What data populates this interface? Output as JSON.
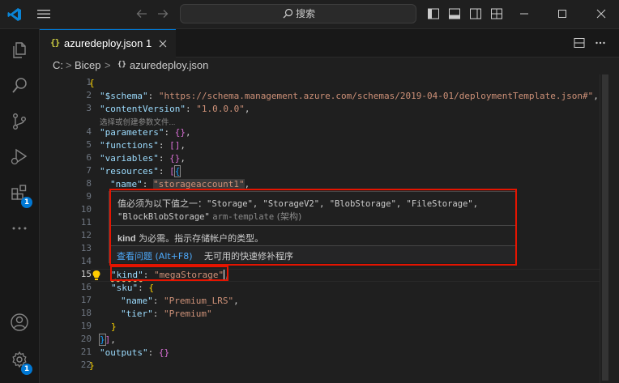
{
  "titlebar": {
    "menu_icon": "hamburger-icon",
    "back_icon": "arrow-left-icon",
    "forward_icon": "arrow-right-icon",
    "search_placeholder": "搜索"
  },
  "activity_bar": {
    "items": [
      {
        "icon": "explorer-icon"
      },
      {
        "icon": "search-icon"
      },
      {
        "icon": "source-control-icon"
      },
      {
        "icon": "run-debug-icon"
      },
      {
        "icon": "extensions-icon",
        "badge": "1"
      },
      {
        "icon": "more-icon"
      }
    ],
    "bottom": [
      {
        "icon": "account-icon"
      },
      {
        "icon": "settings-gear-icon",
        "badge": "1"
      }
    ]
  },
  "tab": {
    "filename": "azuredeploy.json",
    "problem_count": "1"
  },
  "breadcrumb": {
    "drive": "C:",
    "folder": "Bicep",
    "file": "azuredeploy.json",
    "sep": ">"
  },
  "editor": {
    "line_numbers": [
      "1",
      "2",
      "3",
      "",
      "4",
      "5",
      "6",
      "7",
      "8",
      "9",
      "10",
      "11",
      "12",
      "13",
      "14",
      "15",
      "16",
      "17",
      "18",
      "19",
      "20",
      "21",
      "22"
    ],
    "codelens": "选择或创建参数文件...",
    "lines": {
      "l1": "{",
      "l2_key": "\"$schema\"",
      "l2_val": "\"https://schema.management.azure.com/schemas/2019-04-01/deploymentTemplate.json#\"",
      "l3_key": "\"contentVersion\"",
      "l3_val": "\"1.0.0.0\"",
      "l4_key": "\"parameters\"",
      "l5_key": "\"functions\"",
      "l6_key": "\"variables\"",
      "l7_key": "\"resources\"",
      "l8_key": "\"name\"",
      "l8_val": "\"storageaccount1\"",
      "l15_key": "\"kind\"",
      "l15_val": "\"megaStorage\"",
      "l16_key": "\"sku\"",
      "l17_key": "\"name\"",
      "l17_val": "\"Premium_LRS\"",
      "l18_key": "\"tier\"",
      "l18_val": "\"Premium\"",
      "l21_key": "\"outputs\""
    }
  },
  "hover": {
    "message_prefix": "值必须为以下值之一：",
    "values_line1": "\"Storage\", \"StorageV2\", \"BlobStorage\", \"FileStorage\",",
    "values_line2": "\"BlockBlobStorage\"",
    "source": "arm-template",
    "source_suffix": "(架构)",
    "kind_word": "kind",
    "kind_desc": "为必需。指示存储帐户的类型。",
    "view_problem": "查看问题 (Alt+F8)",
    "no_quick_fix": "无可用的快速修补程序"
  },
  "colors": {
    "accent": "#0078d4",
    "error_box": "#e51400",
    "string": "#ce9178",
    "key": "#9cdcfe"
  }
}
